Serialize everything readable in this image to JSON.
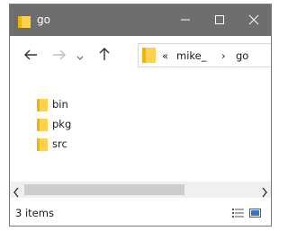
{
  "window": {
    "title": "go"
  },
  "address": {
    "overflow": "«",
    "crumb1": "mike_",
    "separator": "›",
    "crumb2": "go"
  },
  "items": [
    {
      "name": "bin"
    },
    {
      "name": "pkg"
    },
    {
      "name": "src"
    }
  ],
  "status": {
    "count": "3 items"
  },
  "colors": {
    "titlebar": "#6e6e6e",
    "folder": "#ffd24d",
    "scrollthumb": "#cdcdcd"
  }
}
